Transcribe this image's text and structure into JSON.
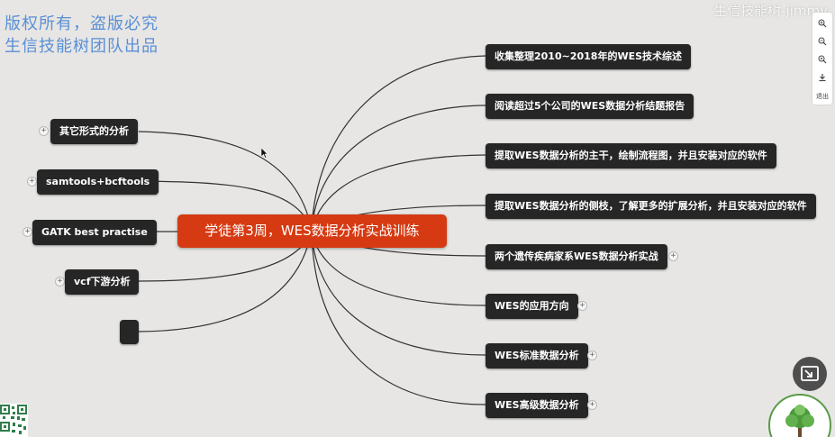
{
  "watermark": {
    "line1": "版权所有，盗版必究",
    "line2": "生信技能树团队出品",
    "top_right": "生信技能树-jimmy"
  },
  "center_topic": "学徒第3周，WES数据分析实战训练",
  "left_nodes": [
    {
      "label": "其它形式的分析",
      "collapsed": true
    },
    {
      "label": "samtools+bcftools",
      "collapsed": true
    },
    {
      "label": "GATK best practise",
      "collapsed": true
    },
    {
      "label": "vcf下游分析",
      "collapsed": true
    },
    {
      "label": "",
      "collapsed": false
    }
  ],
  "right_nodes": [
    {
      "label": "收集整理2010~2018年的WES技术综述",
      "collapsed": false
    },
    {
      "label": "阅读超过5个公司的WES数据分析结题报告",
      "collapsed": false
    },
    {
      "label": "提取WES数据分析的主干，绘制流程图，并且安装对应的软件",
      "collapsed": false
    },
    {
      "label": "提取WES数据分析的侧枝，了解更多的扩展分析，并且安装对应的软件",
      "collapsed": false
    },
    {
      "label": "两个遗传疾病家系WES数据分析实战",
      "collapsed": true
    },
    {
      "label": "WES的应用方向",
      "collapsed": true
    },
    {
      "label": "WES标准数据分析",
      "collapsed": true
    },
    {
      "label": "WES高级数据分析",
      "collapsed": true
    }
  ],
  "toolbar": {
    "buttons": [
      "zoom-in-icon",
      "zoom-out-icon",
      "fit-icon",
      "download-icon"
    ],
    "exit_label": "退出"
  },
  "colors": {
    "background": "#e7e6e4",
    "center_node": "#d63a12",
    "node": "#262626",
    "watermark": "#5a8fd6",
    "connector": "#333333"
  }
}
